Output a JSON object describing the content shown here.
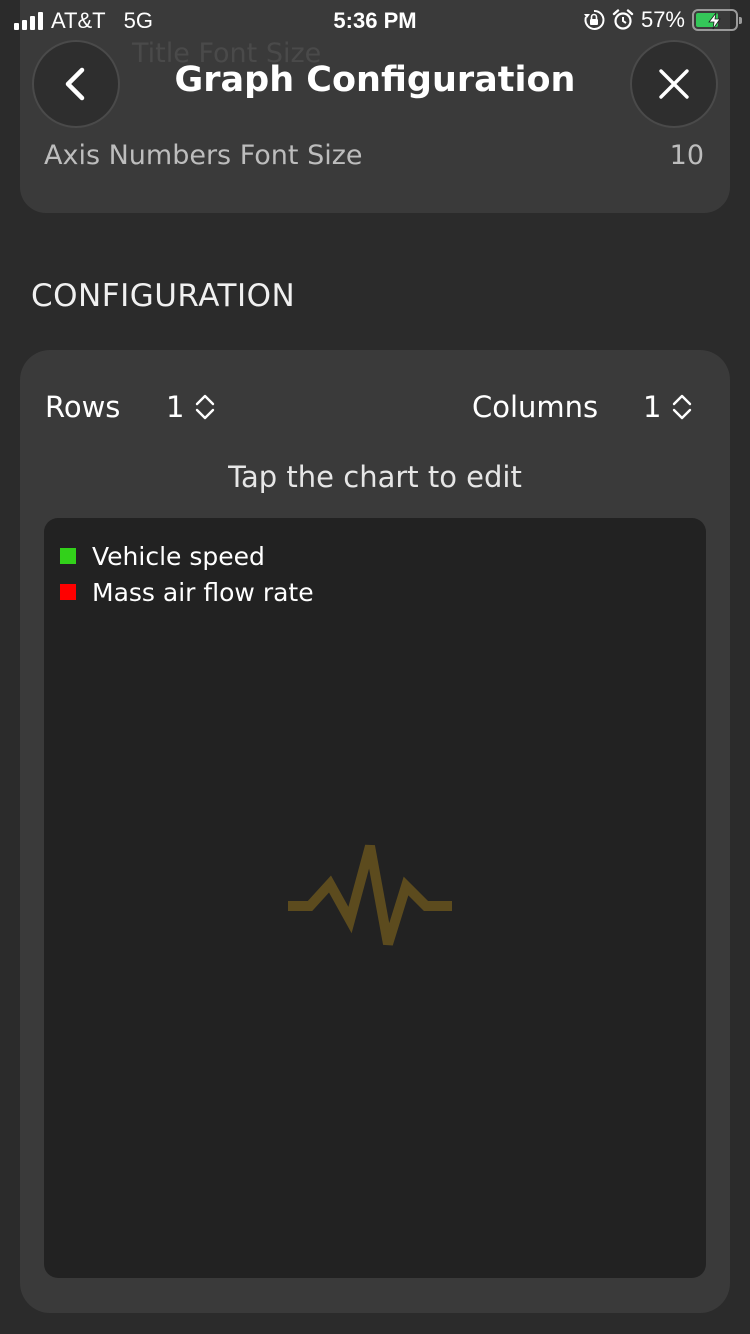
{
  "status_bar": {
    "carrier": "AT&T",
    "network": "5G",
    "time": "5:36 PM",
    "battery_percent": "57%",
    "battery_level": 0.57,
    "icons": [
      "signal-icon",
      "orientation-lock-icon",
      "alarm-icon",
      "battery-charging-icon"
    ]
  },
  "header": {
    "title": "Graph Configuration",
    "back_icon": "chevron-left-icon",
    "close_icon": "close-icon"
  },
  "display_settings": {
    "partial_row_label": "Title Font Size",
    "axis_numbers_label": "Axis Numbers Font Size",
    "axis_numbers_value": "10"
  },
  "configuration": {
    "section_title": "CONFIGURATION",
    "rows_label": "Rows",
    "rows_value": "1",
    "columns_label": "Columns",
    "columns_value": "1",
    "hint": "Tap the chart to edit",
    "legend": [
      {
        "label": "Vehicle speed",
        "color": "#32d11a"
      },
      {
        "label": "Mass air flow rate",
        "color": "#ff0000"
      }
    ],
    "placeholder_icon": "pulse-waveform-icon",
    "placeholder_color": "#5c4b1e"
  }
}
